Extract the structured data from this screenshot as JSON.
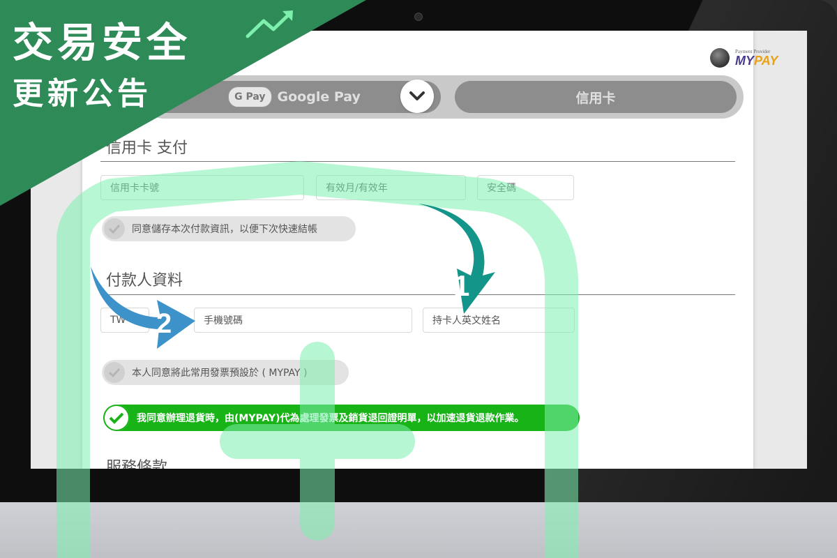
{
  "banner": {
    "title": "交易安全",
    "subtitle": "更新公告"
  },
  "provider": {
    "caption": "Payment Provider",
    "brand_a": "MY",
    "brand_b": "PAY"
  },
  "payment_selector": {
    "gpay_badge": "G Pay",
    "gpay_label": "Google Pay",
    "card_label": "信用卡"
  },
  "card_section": {
    "title": "信用卡 支付",
    "card_number_placeholder": "信用卡卡號",
    "expiry_placeholder": "有效月/有效年",
    "cvv_placeholder": "安全碼",
    "save_info_label": "同意儲存本次付款資訊，以便下次快速結帳"
  },
  "payer_section": {
    "title": "付款人資料",
    "country_code": "TW",
    "phone_placeholder": "手機號碼",
    "holder_name_placeholder": "持卡人英文姓名",
    "invoice_consent_label": "本人同意將此常用發票預設於 ( MYPAY )",
    "refund_consent_label": "我同意辦理退貨時，由(MYPAY)代為處理發票及銷貨退回證明單，以加速退貨退款作業。"
  },
  "terms_section": {
    "title": "服務條款"
  },
  "annotations": {
    "step1": "1",
    "step2": "2"
  },
  "colors": {
    "banner_green": "#2e8a57",
    "watermark_green": "#7ef0ae",
    "check_green": "#17b317",
    "arrow_teal": "#14958a",
    "arrow_blue": "#3d92c9"
  }
}
